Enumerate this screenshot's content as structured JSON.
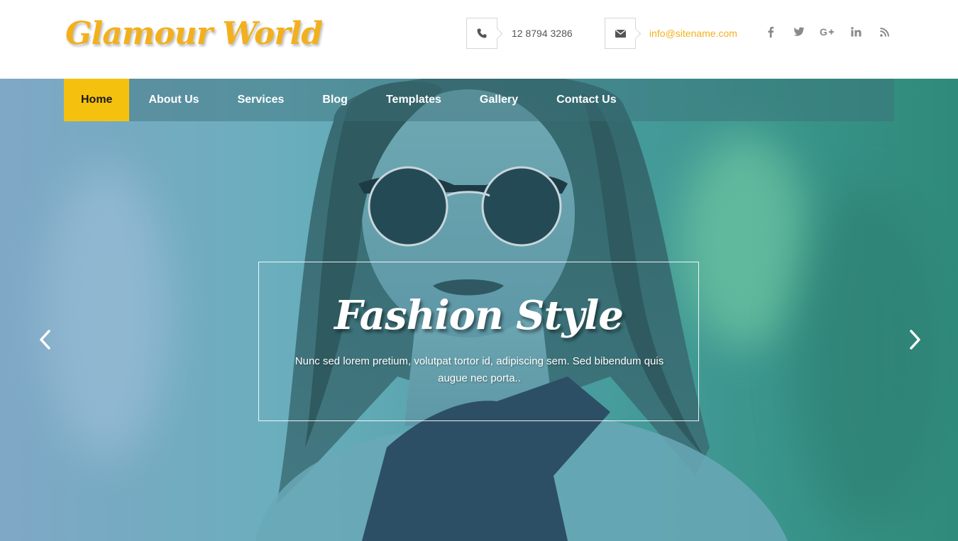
{
  "header": {
    "logo_text": "Glamour World",
    "phone": "12 8794 3286",
    "email": "info@sitename.com",
    "socials": [
      {
        "icon": "facebook-icon",
        "glyph": "f"
      },
      {
        "icon": "twitter-icon",
        "glyph": "ὂ6"
      },
      {
        "icon": "google-plus-icon",
        "glyph": "G+"
      },
      {
        "icon": "linkedin-icon",
        "glyph": "in"
      },
      {
        "icon": "rss-icon",
        "glyph": "rss"
      }
    ]
  },
  "nav": {
    "items": [
      {
        "label": "Home",
        "active": true
      },
      {
        "label": "About Us",
        "active": false
      },
      {
        "label": "Services",
        "active": false
      },
      {
        "label": "Blog",
        "active": false
      },
      {
        "label": "Templates",
        "active": false
      },
      {
        "label": "Gallery",
        "active": false
      },
      {
        "label": "Contact Us",
        "active": false
      }
    ]
  },
  "hero": {
    "title": "Fashion Style",
    "text": "Nunc sed lorem pretium, volutpat tortor id, adipiscing sem. Sed bibendum quis augue nec porta.."
  },
  "colors": {
    "accent": "#f5c10f",
    "logo": "#f2b01e",
    "hero_overlay": "#4e9fa5"
  }
}
